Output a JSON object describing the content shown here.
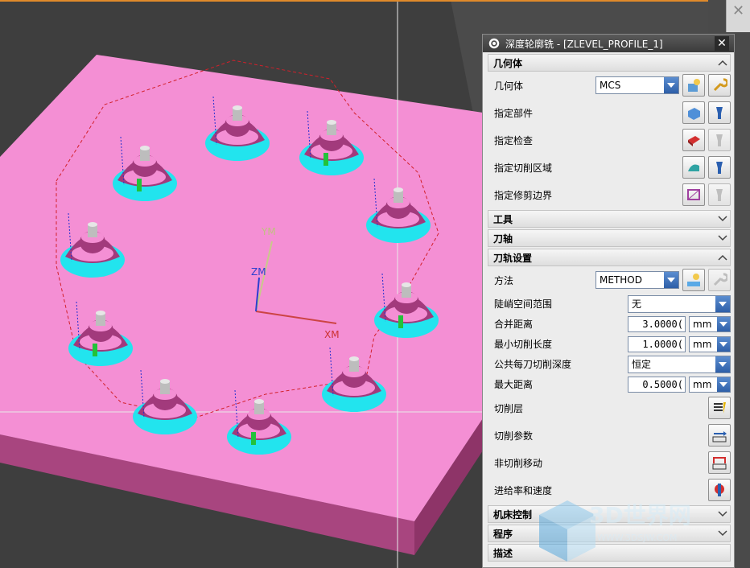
{
  "viewport": {
    "axis_labels": {
      "y": "YM",
      "z": "ZM",
      "x": "XM"
    },
    "colors": {
      "part": "#f48fd4",
      "stock_side": "#a23a7c",
      "cyan": "#22e4ee",
      "background": "#3e3e3e"
    }
  },
  "dialog": {
    "title": "深度轮廓铣 - [ZLEVEL_PROFILE_1]",
    "sections": {
      "geometry": {
        "header": "几何体",
        "geometry_label": "几何体",
        "geometry_value": "MCS",
        "specify_part": "指定部件",
        "specify_check": "指定检查",
        "specify_cut_area": "指定切削区域",
        "specify_trim": "指定修剪边界"
      },
      "tool": {
        "header": "工具"
      },
      "axis": {
        "header": "刀轴"
      },
      "path_settings": {
        "header": "刀轨设置",
        "method_label": "方法",
        "method_value": "METHOD",
        "steep_label": "陡峭空间范围",
        "steep_value": "无",
        "merge_label": "合并距离",
        "merge_value": "3.0000(",
        "merge_unit": "mm",
        "min_cut_label": "最小切削长度",
        "min_cut_value": "1.0000(",
        "min_cut_unit": "mm",
        "depth_label": "公共每刀切削深度",
        "depth_value": "恒定",
        "max_dist_label": "最大距离",
        "max_dist_value": "0.5000(",
        "max_dist_unit": "mm",
        "cut_levels": "切削层",
        "cut_params": "切削参数",
        "non_cut": "非切削移动",
        "feeds": "进给率和速度"
      },
      "machine": {
        "header": "机床控制"
      },
      "program": {
        "header": "程序"
      },
      "desc": {
        "header": "描述"
      }
    }
  },
  "watermark": {
    "text": "3D世界网",
    "sub": "WWW.3DSJW.COM"
  }
}
